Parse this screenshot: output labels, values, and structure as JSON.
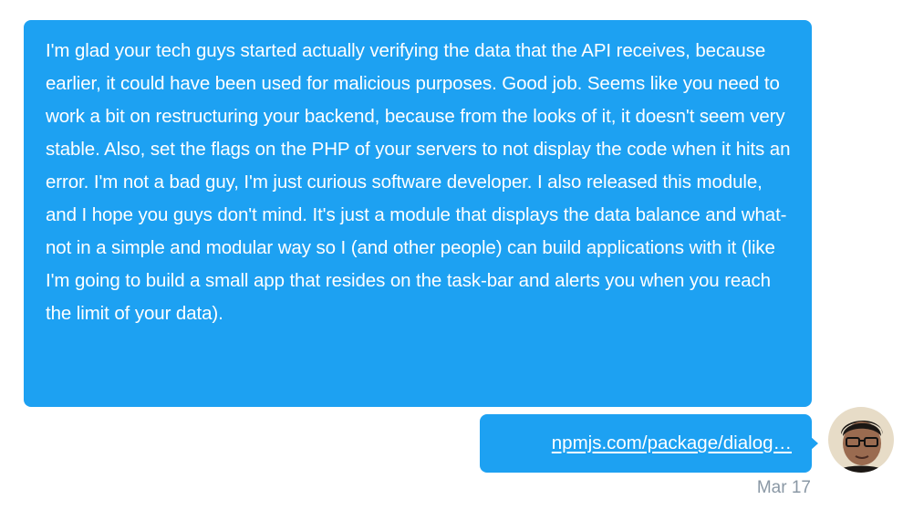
{
  "conversation": {
    "messages": [
      {
        "text": "I'm glad your tech guys started actually verifying the data that the API receives, because earlier, it could have been used for malicious purposes. Good job. Seems like you need to work a bit on restructuring your backend, because from the looks of it, it doesn't seem very stable. Also, set the flags on the PHP of your servers to not display the code when it hits an error. I'm not a bad guy, I'm just curious software developer. I also released this module, and I hope you guys don't mind. It's just a module that displays the data balance and what-not in a simple and modular way so I (and other people) can build applications with it (like I'm going to build a small app that resides on the task-bar and alerts you when you reach the limit of your data)."
      },
      {
        "link_text": "npmjs.com/package/dialog…"
      }
    ],
    "timestamp": "Mar 17"
  },
  "colors": {
    "bubble": "#1da1f2",
    "bubble_text": "#ffffff",
    "timestamp": "#8a98a5"
  }
}
